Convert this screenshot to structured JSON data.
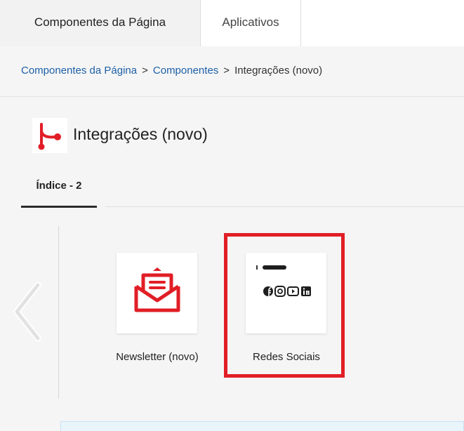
{
  "tabs": [
    {
      "label": "Componentes da Página",
      "active": true
    },
    {
      "label": "Aplicativos",
      "active": false
    }
  ],
  "breadcrumb": {
    "items": [
      "Componentes da Página",
      "Componentes"
    ],
    "current": "Integrações (novo)",
    "separator": ">"
  },
  "header": {
    "icon": "integration-share-icon",
    "title": "Integrações (novo)"
  },
  "index_tab": {
    "label": "Índice - 2"
  },
  "components": [
    {
      "label": "Newsletter (novo)",
      "icon": "newsletter-envelope-icon"
    },
    {
      "label": "Redes Sociais",
      "icon": "social-networks-icon",
      "highlighted": true
    }
  ],
  "colors": {
    "accent_red": "#e11e26",
    "link_blue": "#1d5fa6"
  }
}
